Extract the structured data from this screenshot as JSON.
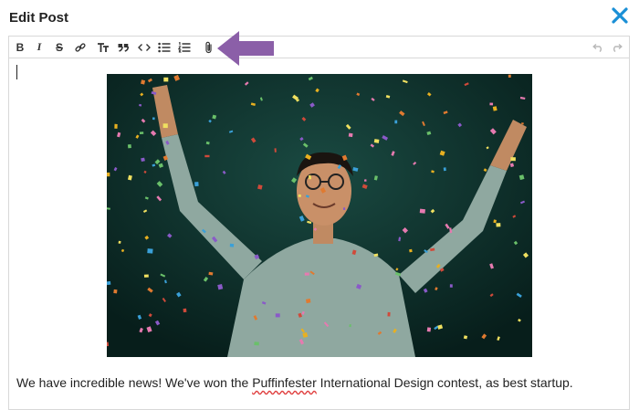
{
  "dialog": {
    "title": "Edit Post",
    "close_icon": "close-icon",
    "accent_color": "#1a8fd6"
  },
  "toolbar": {
    "buttons": [
      {
        "name": "bold",
        "glyph": "B"
      },
      {
        "name": "italic",
        "glyph": "I"
      },
      {
        "name": "strikethrough",
        "glyph": "S"
      },
      {
        "name": "link",
        "glyph": "link-icon"
      },
      {
        "name": "heading",
        "glyph": "heading-icon"
      },
      {
        "name": "quote",
        "glyph": "quote-icon"
      },
      {
        "name": "code",
        "glyph": "code-icon"
      },
      {
        "name": "bullet-list",
        "glyph": "bullet-list-icon"
      },
      {
        "name": "numbered-list",
        "glyph": "numbered-list-icon"
      },
      {
        "name": "attach",
        "glyph": "paperclip-icon"
      }
    ],
    "undo_icon": "undo-icon",
    "redo_icon": "redo-icon"
  },
  "annotation": {
    "arrow_color": "#8b5fa8"
  },
  "content": {
    "text_before": "We have incredible news!  We've won the ",
    "misspelled_word": "Puffinfester",
    "text_after": " International Design contest, as best startup."
  }
}
